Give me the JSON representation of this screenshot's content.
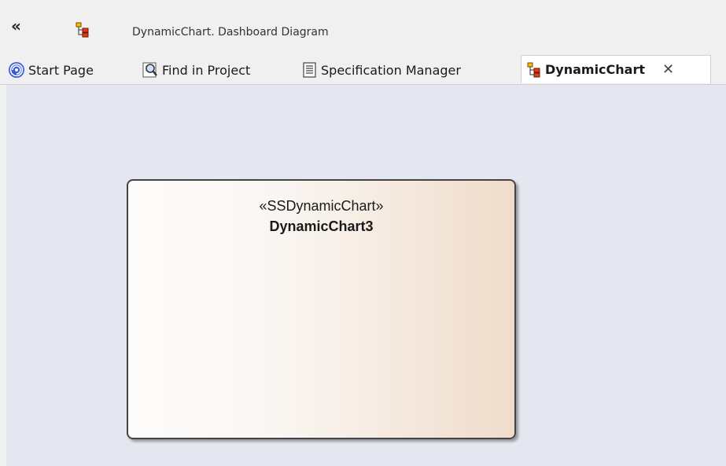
{
  "toolbar": {
    "collapse_glyph": "«",
    "breadcrumb": "DynamicChart.  Dashboard Diagram",
    "diagram_icon": "diagram-icon"
  },
  "tabs": [
    {
      "label": "Start Page",
      "icon": "start-page-icon",
      "active": false
    },
    {
      "label": "Find in Project",
      "icon": "find-in-project-icon",
      "active": false
    },
    {
      "label": "Specification Manager",
      "icon": "specification-manager-icon",
      "active": false
    },
    {
      "label": "DynamicChart",
      "icon": "diagram-icon",
      "active": true,
      "close_glyph": "✕"
    }
  ],
  "diagram": {
    "element": {
      "stereotype": "«SSDynamicChart»",
      "name": "DynamicChart3"
    }
  },
  "colors": {
    "canvas_bg": "#e4e7f0",
    "element_gradient_start": "#fdfcfb",
    "element_gradient_end": "#f0dccb",
    "start_page_icon": "#3a5bd9"
  }
}
